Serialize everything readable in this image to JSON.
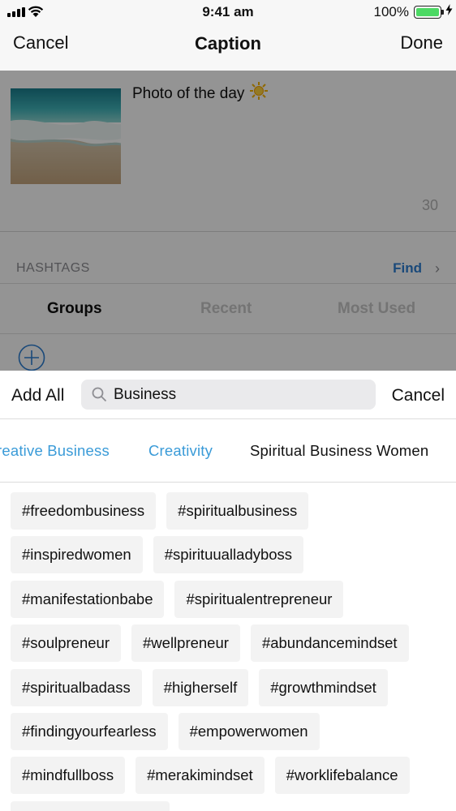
{
  "status_bar": {
    "time": "9:41 am",
    "battery_percent": "100%",
    "battery_color": "#4cd964"
  },
  "nav": {
    "cancel_label": "Cancel",
    "title": "Caption",
    "done_label": "Done"
  },
  "caption": {
    "text": "Photo of the day",
    "emoji_icon": "sun-icon",
    "char_count": "30"
  },
  "hashtags": {
    "section_label": "HASHTAGS",
    "find_label": "Find",
    "segments": [
      "Groups",
      "Recent",
      "Most Used"
    ],
    "selected_segment": "Groups"
  },
  "search": {
    "add_all_label": "Add All",
    "query": "Business",
    "cancel_label": "Cancel"
  },
  "group_results": [
    {
      "label": "reative Business",
      "selected": false
    },
    {
      "label": "Creativity",
      "selected": false
    },
    {
      "label": "Spiritual Business Women",
      "selected": true
    }
  ],
  "tag_rows": [
    [
      "#freedombusiness",
      "#spiritualbusiness"
    ],
    [
      "#inspiredwomen",
      "#spirituualladyboss"
    ],
    [
      "#manifestationbabe",
      "#spiritualentrepreneur"
    ],
    [
      "#soulpreneur",
      "#wellpreneur",
      "#abundancemindset"
    ],
    [
      "#spiritualbadass",
      "#higherself",
      "#growthmindset"
    ],
    [
      "#findingyourfearless",
      "#empowerwomen"
    ],
    [
      "#mindfullboss",
      "#merakimindset",
      "#worklifebalance"
    ]
  ],
  "colors": {
    "accent_blue": "#2d7fd3",
    "group_link_blue": "#3a9bd8",
    "tag_background": "#f3f3f3"
  }
}
